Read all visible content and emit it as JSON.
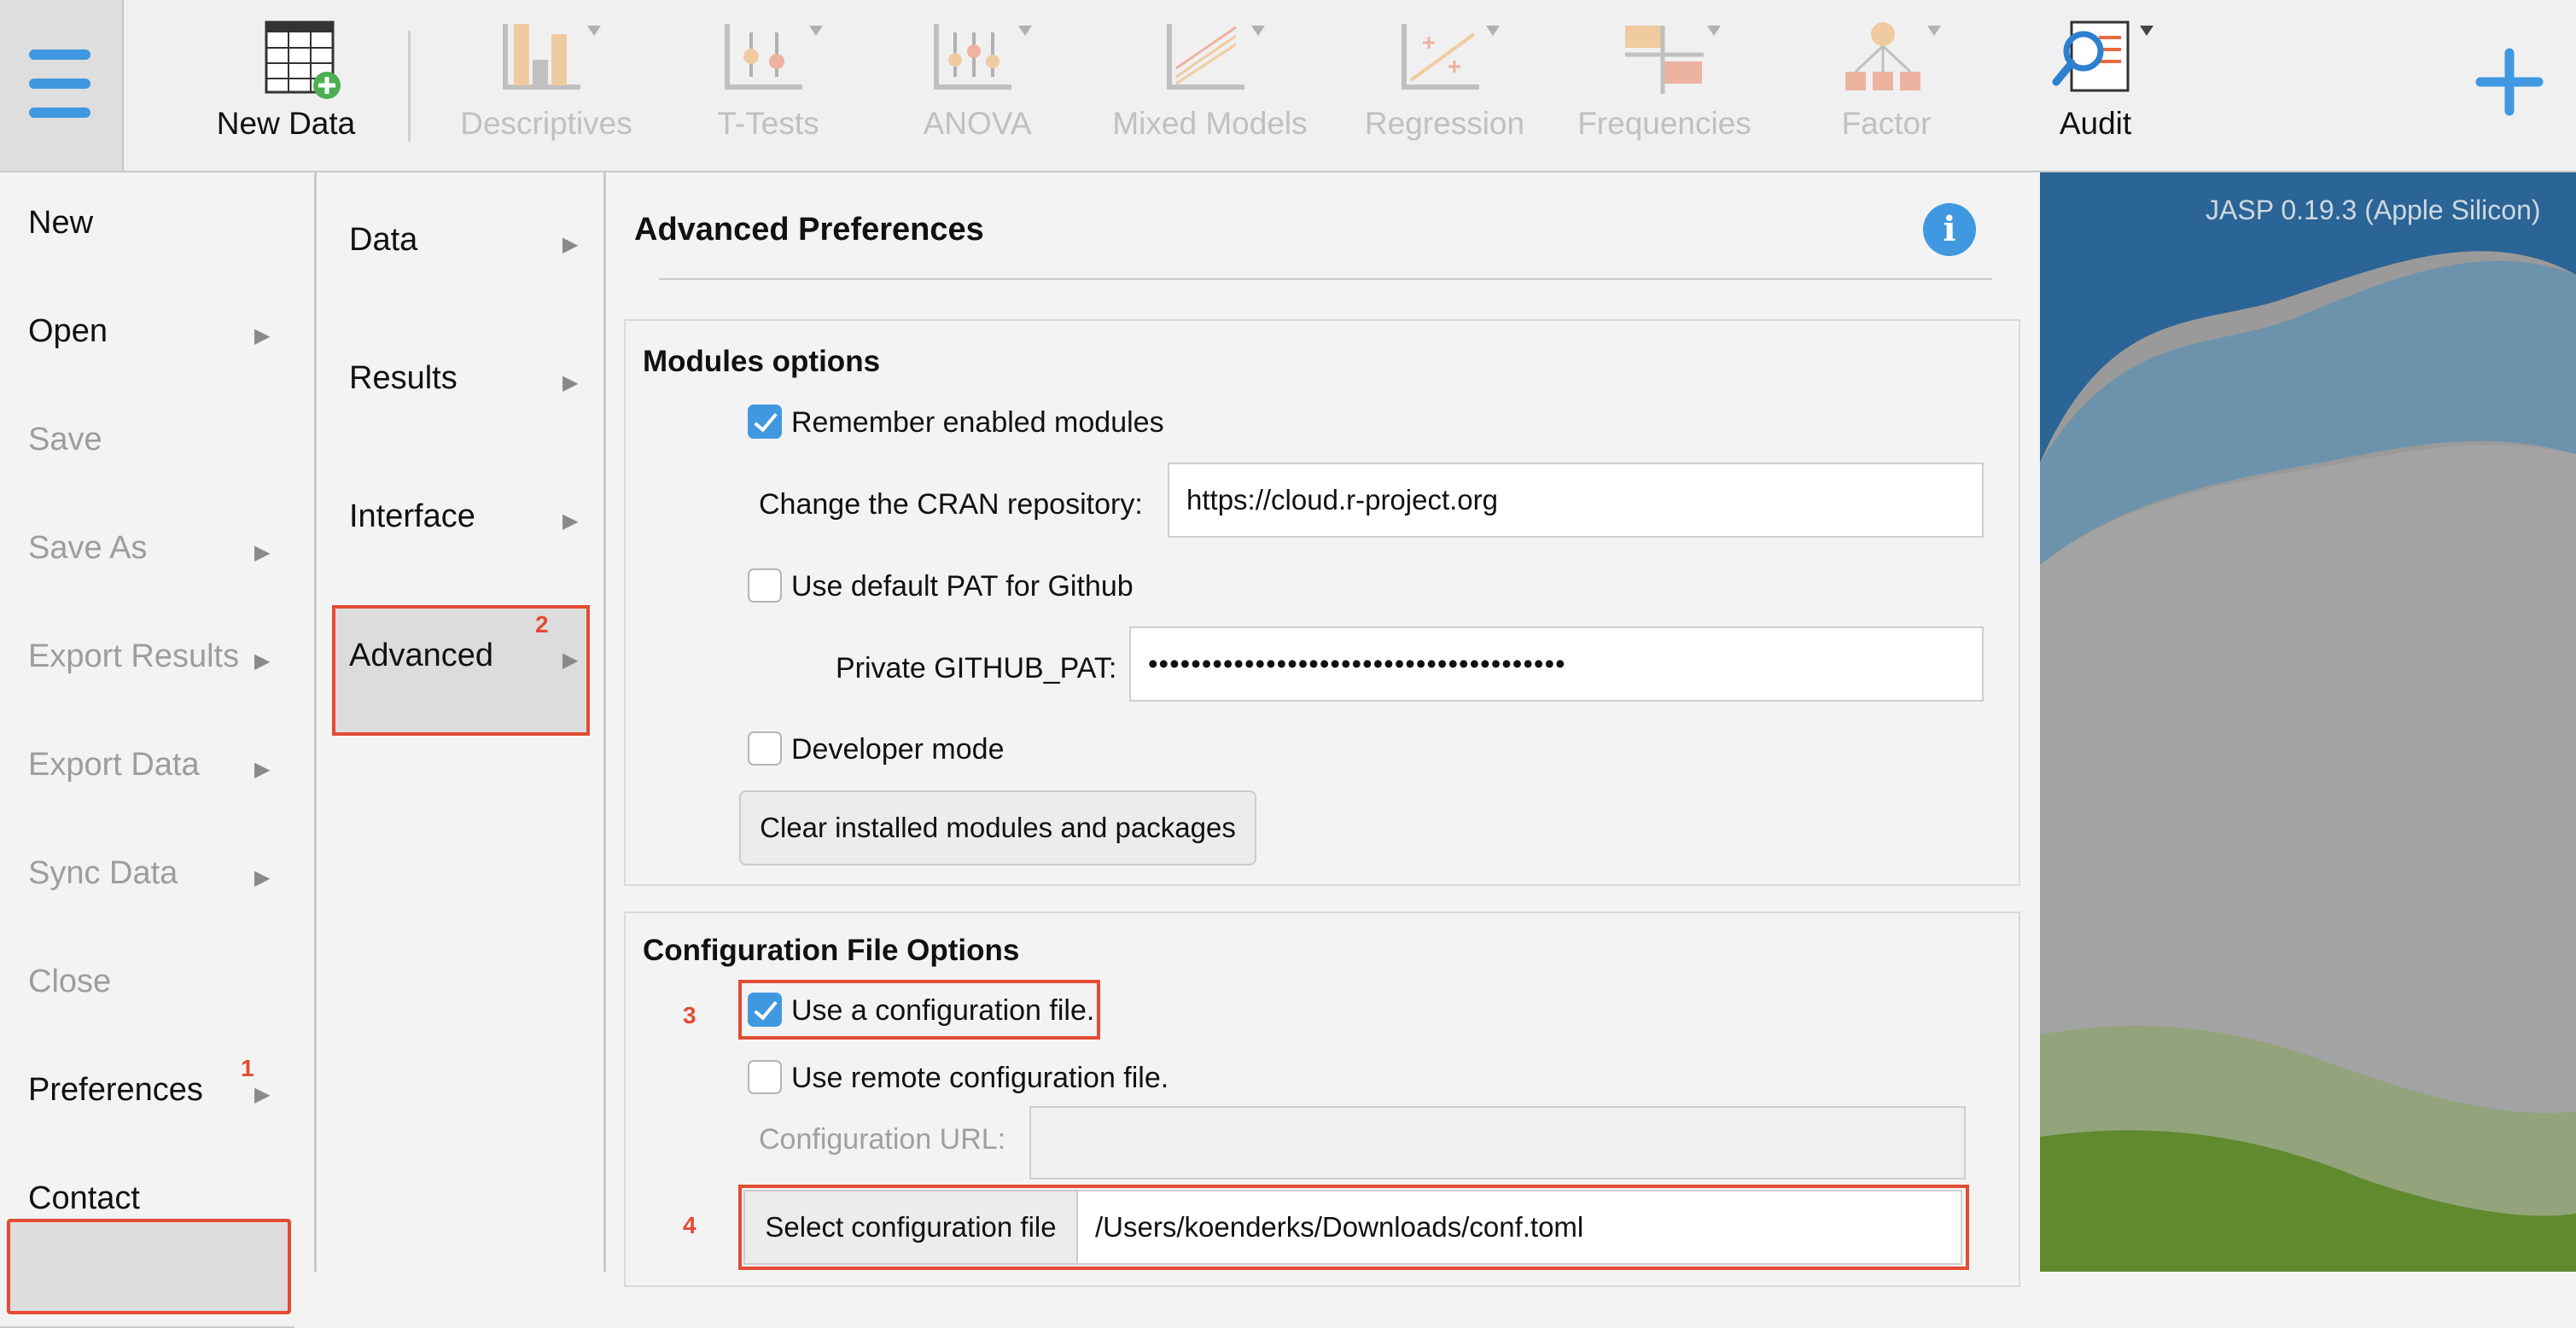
{
  "toolbar": {
    "items": [
      {
        "label": "New Data",
        "enabled": true,
        "icon": "new-data-icon"
      },
      {
        "label": "Descriptives",
        "enabled": false,
        "icon": "descriptives-icon"
      },
      {
        "label": "T-Tests",
        "enabled": false,
        "icon": "t-tests-icon"
      },
      {
        "label": "ANOVA",
        "enabled": false,
        "icon": "anova-icon"
      },
      {
        "label": "Mixed Models",
        "enabled": false,
        "icon": "mixed-models-icon"
      },
      {
        "label": "Regression",
        "enabled": false,
        "icon": "regression-icon"
      },
      {
        "label": "Frequencies",
        "enabled": false,
        "icon": "frequencies-icon"
      },
      {
        "label": "Factor",
        "enabled": false,
        "icon": "factor-icon"
      },
      {
        "label": "Audit",
        "enabled": true,
        "icon": "audit-icon"
      }
    ],
    "add_icon": "plus-icon",
    "menu_icon": "hamburger-menu-icon"
  },
  "file_menu": {
    "items": [
      {
        "label": "New",
        "enabled": true,
        "has_submenu": false
      },
      {
        "label": "Open",
        "enabled": true,
        "has_submenu": true
      },
      {
        "label": "Save",
        "enabled": false,
        "has_submenu": false
      },
      {
        "label": "Save As",
        "enabled": false,
        "has_submenu": true
      },
      {
        "label": "Export Results",
        "enabled": false,
        "has_submenu": true
      },
      {
        "label": "Export Data",
        "enabled": false,
        "has_submenu": true
      },
      {
        "label": "Sync Data",
        "enabled": false,
        "has_submenu": true
      },
      {
        "label": "Close",
        "enabled": false,
        "has_submenu": false
      },
      {
        "label": "Preferences",
        "enabled": true,
        "has_submenu": true,
        "selected": true
      },
      {
        "label": "Contact",
        "enabled": true,
        "has_submenu": false
      }
    ]
  },
  "preferences_menu": {
    "items": [
      {
        "label": "Data"
      },
      {
        "label": "Results"
      },
      {
        "label": "Interface"
      },
      {
        "label": "Advanced",
        "selected": true
      }
    ]
  },
  "callouts": {
    "one": "1",
    "two": "2",
    "three": "3",
    "four": "4"
  },
  "panel": {
    "title": "Advanced Preferences",
    "info_icon": "info-icon",
    "modules": {
      "title": "Modules options",
      "remember_label": "Remember enabled modules",
      "remember_checked": true,
      "cran_label": "Change the CRAN repository:",
      "cran_value": "https://cloud.r-project.org",
      "pat_default_label": "Use default PAT for Github",
      "pat_default_checked": false,
      "pat_label": "Private GITHUB_PAT:",
      "pat_value": "•••••••••••••••••••••••••••••••••••••••",
      "dev_label": "Developer mode",
      "dev_checked": false,
      "clear_button": "Clear installed modules and packages"
    },
    "config": {
      "title": "Configuration File Options",
      "use_config_label": "Use a configuration file.",
      "use_config_checked": true,
      "remote_label": "Use remote configuration file.",
      "remote_checked": false,
      "url_label": "Configuration URL:",
      "url_value": "",
      "select_button": "Select configuration file",
      "file_path": "/Users/koenderks/Downloads/conf.toml"
    }
  },
  "version": "JASP 0.19.3 (Apple Silicon)",
  "colors": {
    "accent": "#3f98e0",
    "highlight": "#e24c33"
  }
}
